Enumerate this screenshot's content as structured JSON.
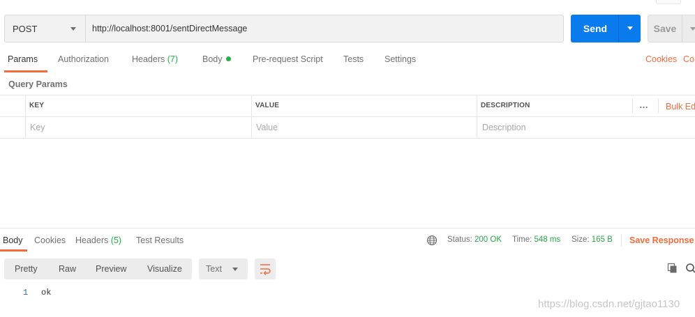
{
  "request": {
    "method": "POST",
    "url": "http://localhost:8001/sentDirectMessage",
    "send_label": "Send",
    "save_label": "Save"
  },
  "tabs": [
    {
      "label": "Params",
      "active": true
    },
    {
      "label": "Authorization"
    },
    {
      "label": "Headers",
      "count": "(7)"
    },
    {
      "label": "Body",
      "indicator": "green-dot"
    },
    {
      "label": "Pre-request Script"
    },
    {
      "label": "Tests"
    },
    {
      "label": "Settings"
    }
  ],
  "links": {
    "cookies": "Cookies",
    "code": "Co"
  },
  "query_params": {
    "title": "Query Params",
    "columns": [
      "KEY",
      "VALUE",
      "DESCRIPTION"
    ],
    "more_icon": "…",
    "bulk_edit": "Bulk Ed",
    "placeholders": {
      "key": "Key",
      "value": "Value",
      "description": "Description"
    }
  },
  "response": {
    "tabs": [
      {
        "label": "Body",
        "active": true
      },
      {
        "label": "Cookies"
      },
      {
        "label": "Headers",
        "count": "(5)"
      },
      {
        "label": "Test Results"
      }
    ],
    "status_label": "Status:",
    "status_value": "200 OK",
    "time_label": "Time:",
    "time_value": "548 ms",
    "size_label": "Size:",
    "size_value": "165 B",
    "save_response": "Save Response",
    "views": [
      "Pretty",
      "Raw",
      "Preview",
      "Visualize"
    ],
    "format": "Text",
    "body_lines": [
      {
        "number": "1",
        "text": "ok"
      }
    ]
  },
  "colors": {
    "accent": "#f26b3a",
    "send_blue": "#097bed",
    "status_green": "#26a745"
  },
  "watermark": "https://blog.csdn.net/gjtao1130"
}
